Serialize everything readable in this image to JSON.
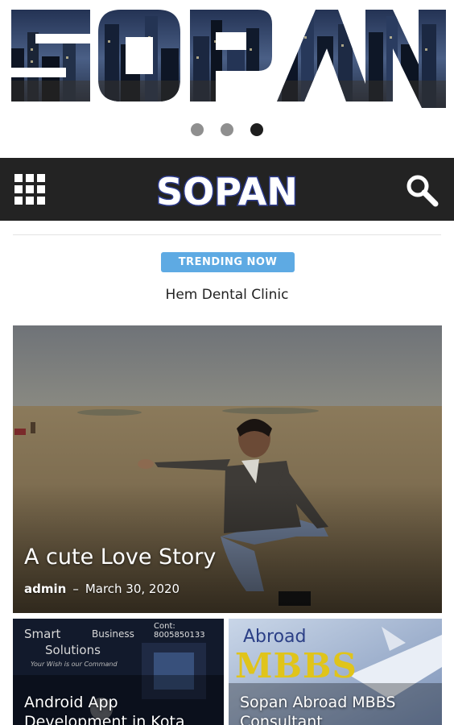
{
  "hero": {
    "brand_text": "SOPAN",
    "slides": 3,
    "active_slide": 3
  },
  "header": {
    "logo_text": "SOPAN",
    "menu_icon": "grid-menu-icon",
    "search_icon": "search-icon"
  },
  "trending": {
    "badge": "TRENDING NOW",
    "title": "Hem Dental Clinic"
  },
  "featured": {
    "title": "A cute Love Story",
    "author": "admin",
    "separator": "–",
    "date": "March 30, 2020"
  },
  "cards": [
    {
      "title": "Android App Development in Kota",
      "image_text": {
        "brand_line1": "Smart",
        "brand_line1b": "Business",
        "brand_line2": "Solutions",
        "tagline": "Your Wish is our Command",
        "contact": "Cont: 8005850133"
      }
    },
    {
      "title": "Sopan Abroad MBBS Consultant",
      "image_text": {
        "abroad": "Abroad",
        "mbbs": "MBBS"
      }
    }
  ],
  "colors": {
    "header_bg": "#232323",
    "badge_bg": "#5eaae3",
    "dot_active": "#1e1e1e",
    "dot_inactive": "#8f8f8f"
  }
}
